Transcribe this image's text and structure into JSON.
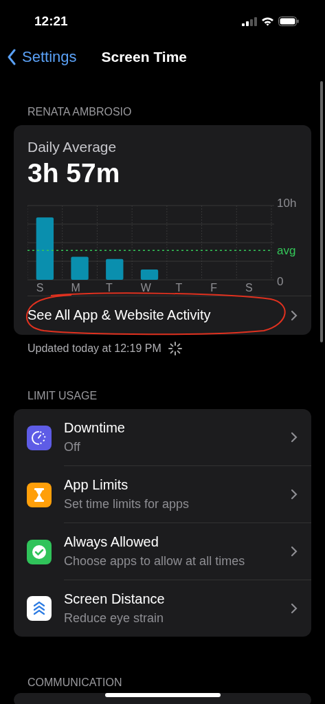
{
  "status_bar": {
    "time": "12:21"
  },
  "nav": {
    "back": "Settings",
    "title": "Screen Time"
  },
  "profile_header": "RENATA AMBROSIO",
  "summary": {
    "label": "Daily Average",
    "value": "3h 57m",
    "chart_data": {
      "type": "bar",
      "categories": [
        "S",
        "M",
        "T",
        "W",
        "T",
        "F",
        "S"
      ],
      "series": [
        {
          "color": "#0a8fae",
          "values": [
            8.4,
            3.1,
            2.8,
            1.4,
            null,
            null,
            null
          ]
        }
      ],
      "ylim": [
        0,
        10
      ],
      "yticks": [
        {
          "value": 0,
          "label": "0"
        },
        {
          "value": 10,
          "label": "10h"
        }
      ],
      "ref_lines": [
        {
          "axis": "y",
          "value": 3.95,
          "label": "avg",
          "color": "#34c759"
        }
      ]
    },
    "link": "See All App & Website Activity"
  },
  "updated": "Updated today at 12:19 PM",
  "limit_header": "LIMIT USAGE",
  "limit_items": [
    {
      "kind": "downtime",
      "title": "Downtime",
      "subtitle": "Off"
    },
    {
      "kind": "limits",
      "title": "App Limits",
      "subtitle": "Set time limits for apps"
    },
    {
      "kind": "allowed",
      "title": "Always Allowed",
      "subtitle": "Choose apps to allow at all times"
    },
    {
      "kind": "distance",
      "title": "Screen Distance",
      "subtitle": "Reduce eye strain"
    }
  ],
  "communication_header": "COMMUNICATION"
}
